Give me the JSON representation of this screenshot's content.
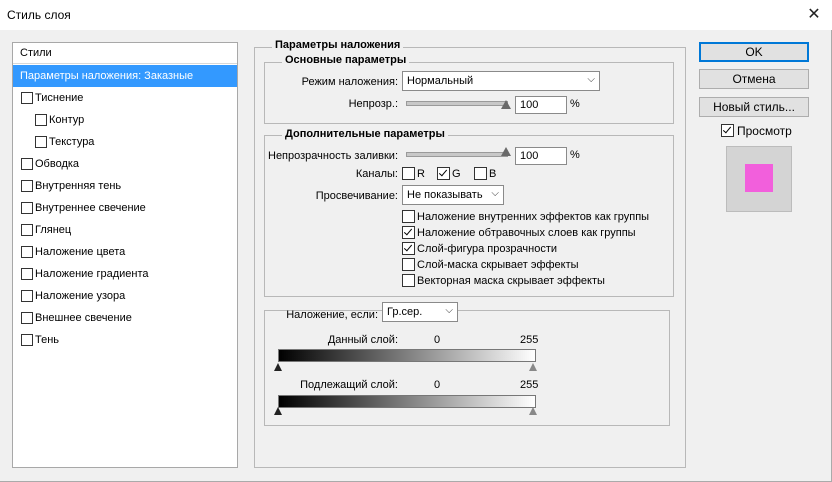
{
  "window": {
    "title": "Стиль слоя",
    "close_glyph": "✕"
  },
  "styles_panel": {
    "header": "Стили",
    "items": [
      {
        "label": "Параметры наложения: Заказные",
        "checkbox": false,
        "selected": true,
        "indent": 0
      },
      {
        "label": "Тиснение",
        "checkbox": true,
        "checked": false,
        "indent": 0
      },
      {
        "label": "Контур",
        "checkbox": true,
        "checked": false,
        "indent": 1
      },
      {
        "label": "Текстура",
        "checkbox": true,
        "checked": false,
        "indent": 1
      },
      {
        "label": "Обводка",
        "checkbox": true,
        "checked": false,
        "indent": 0
      },
      {
        "label": "Внутренняя тень",
        "checkbox": true,
        "checked": false,
        "indent": 0
      },
      {
        "label": "Внутреннее свечение",
        "checkbox": true,
        "checked": false,
        "indent": 0
      },
      {
        "label": "Глянец",
        "checkbox": true,
        "checked": false,
        "indent": 0
      },
      {
        "label": "Наложение цвета",
        "checkbox": true,
        "checked": false,
        "indent": 0
      },
      {
        "label": "Наложение градиента",
        "checkbox": true,
        "checked": false,
        "indent": 0
      },
      {
        "label": "Наложение узора",
        "checkbox": true,
        "checked": false,
        "indent": 0
      },
      {
        "label": "Внешнее свечение",
        "checkbox": true,
        "checked": false,
        "indent": 0
      },
      {
        "label": "Тень",
        "checkbox": true,
        "checked": false,
        "indent": 0
      }
    ]
  },
  "blending_options": {
    "legend": "Параметры наложения",
    "general": {
      "legend": "Основные параметры",
      "blend_mode_label": "Режим наложения:",
      "blend_mode_value": "Нормальный",
      "opacity_label": "Непрозр.:",
      "opacity_value": "100",
      "opacity_unit": "%",
      "opacity_level": 1.0
    },
    "advanced": {
      "legend": "Дополнительные параметры",
      "fill_opacity_label": "Непрозрачность заливки:",
      "fill_opacity_value": "100",
      "fill_opacity_unit": "%",
      "fill_opacity_level": 1.0,
      "channels_label": "Каналы:",
      "channels": [
        {
          "label": "R",
          "checked": false
        },
        {
          "label": "G",
          "checked": true
        },
        {
          "label": "B",
          "checked": false
        }
      ],
      "knockout_label": "Просвечивание:",
      "knockout_value": "Не показывать",
      "options": [
        {
          "label": "Наложение внутренних эффектов как группы",
          "checked": false
        },
        {
          "label": "Наложение обтравочных слоев как группы",
          "checked": true
        },
        {
          "label": "Слой-фигура прозрачности",
          "checked": true
        },
        {
          "label": "Слой-маска скрывает эффекты",
          "checked": false
        },
        {
          "label": "Векторная маска скрывает эффекты",
          "checked": false
        }
      ]
    },
    "blend_if": {
      "label": "Наложение, если:",
      "value": "Гр.сер.",
      "this_layer_label": "Данный слой:",
      "this_layer_min": "0",
      "this_layer_max": "255",
      "underlying_label": "Подлежащий слой:",
      "underlying_min": "0",
      "underlying_max": "255"
    }
  },
  "buttons": {
    "ok": "OK",
    "cancel": "Отмена",
    "new_style": "Новый стиль...",
    "preview_label": "Просмотр",
    "preview_checked": true
  },
  "colors": {
    "preview_swatch": "#f25fdc",
    "selection": "#3399ff"
  }
}
